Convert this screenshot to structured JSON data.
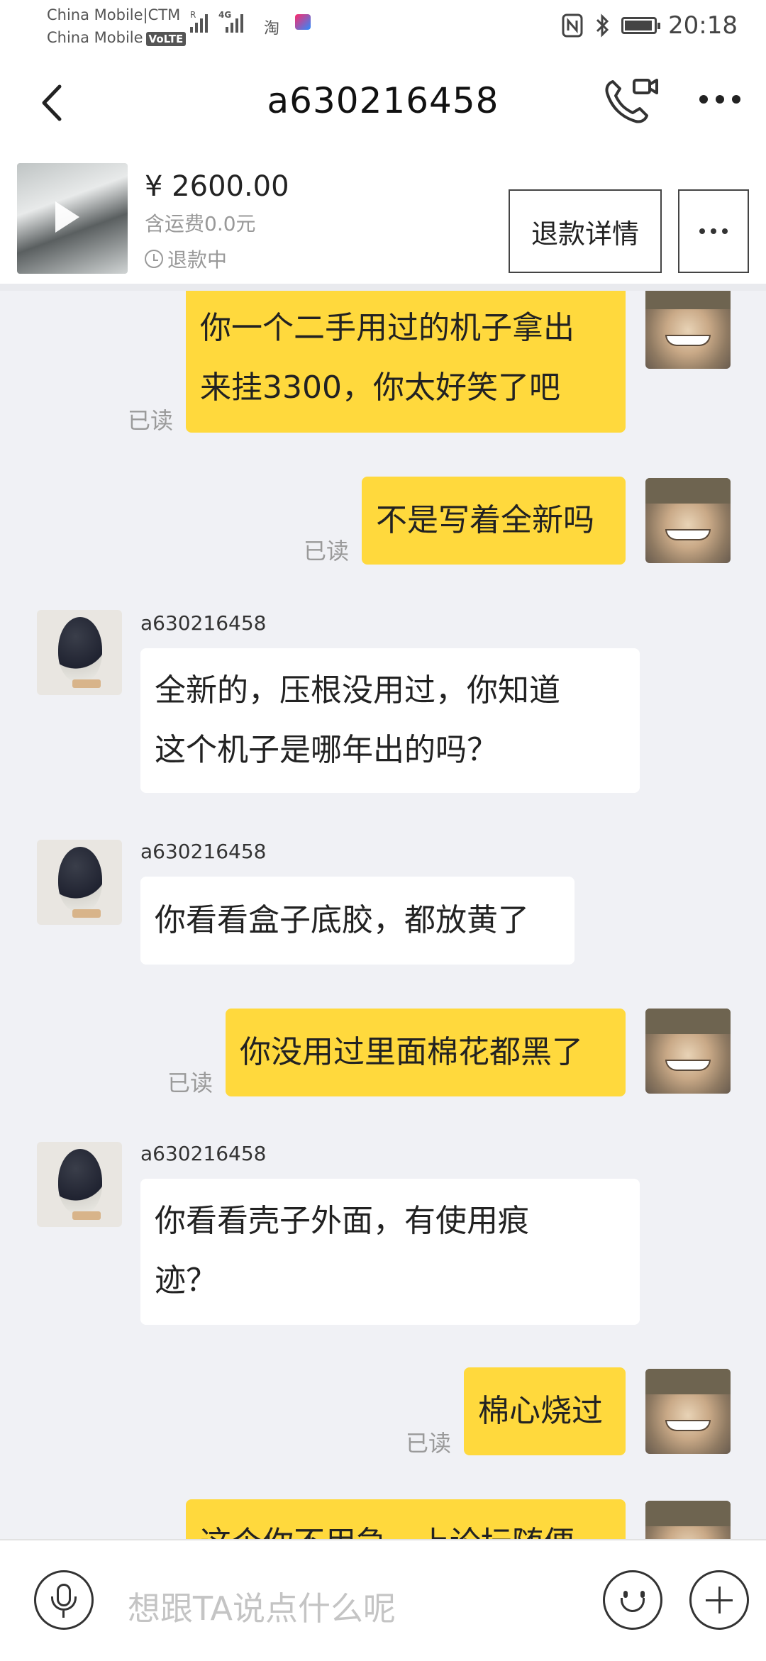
{
  "status_bar": {
    "carrier_1": "China Mobile|CTM",
    "carrier_2": "China Mobile",
    "volte": "VoLTE",
    "sig_r": "R",
    "sig_4g": "4G",
    "taobao_icon": "淘",
    "time": "20:18",
    "battery_level": 0.95
  },
  "nav": {
    "title": "a630216458",
    "icons": [
      "back-icon",
      "video-call-icon",
      "more-icon"
    ]
  },
  "product": {
    "price": "¥ 2600.00",
    "shipping": "含运费0.0元",
    "status": "退款中",
    "refund_button": "退款详情"
  },
  "messages": [
    {
      "side": "me",
      "text": "你一个二手用过的机子拿出\n来挂3300，你太好笑了吧",
      "read": "已读"
    },
    {
      "side": "me",
      "text": "不是写着全新吗",
      "read": "已读"
    },
    {
      "side": "them",
      "sender": "a630216458",
      "text": "全新的，压根没用过，你知道\n这个机子是哪年出的吗？"
    },
    {
      "side": "them",
      "sender": "a630216458",
      "text": "你看看盒子底胶，都放黄了"
    },
    {
      "side": "me",
      "text": "你没用过里面棉花都黑了",
      "read": "已读"
    },
    {
      "side": "them",
      "sender": "a630216458",
      "text": "你看看壳子外面，有使用痕\n迹？"
    },
    {
      "side": "me",
      "text": "棉心烧过",
      "read": "已读"
    },
    {
      "side": "me",
      "text": "这个你不用急，上论坛随便"
    }
  ],
  "input": {
    "placeholder": "想跟TA说点什么呢"
  }
}
